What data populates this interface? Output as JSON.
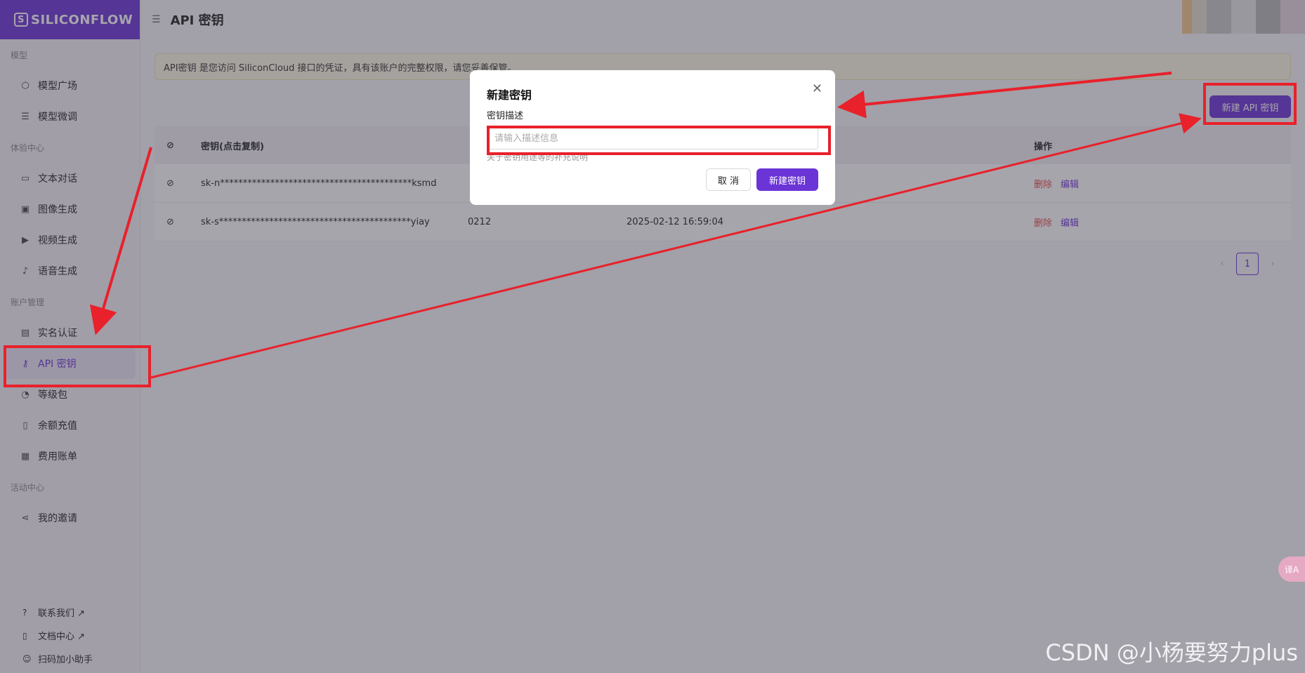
{
  "app": {
    "logo_text": "SILICONFLOW",
    "page_title": "API 密钥"
  },
  "sidebar": {
    "sections": [
      {
        "title": "模型",
        "items": [
          {
            "label": "模型广场",
            "icon": "cube-icon"
          },
          {
            "label": "模型微调",
            "icon": "sliders-icon"
          }
        ]
      },
      {
        "title": "体验中心",
        "items": [
          {
            "label": "文本对话",
            "icon": "chat-icon"
          },
          {
            "label": "图像生成",
            "icon": "image-icon"
          },
          {
            "label": "视频生成",
            "icon": "video-icon"
          },
          {
            "label": "语音生成",
            "icon": "mic-icon"
          }
        ]
      },
      {
        "title": "账户管理",
        "items": [
          {
            "label": "实名认证",
            "icon": "id-card-icon"
          },
          {
            "label": "API 密钥",
            "icon": "key-icon",
            "active": true
          },
          {
            "label": "等级包",
            "icon": "gauge-icon"
          },
          {
            "label": "余额充值",
            "icon": "wallet-icon"
          },
          {
            "label": "费用账单",
            "icon": "bill-icon"
          }
        ]
      },
      {
        "title": "活动中心",
        "items": [
          {
            "label": "我的邀请",
            "icon": "share-icon"
          }
        ]
      }
    ],
    "bottom": [
      {
        "label": "联系我们 ↗"
      },
      {
        "label": "文档中心 ↗"
      },
      {
        "label": "扫码加小助手"
      }
    ]
  },
  "notice": "API密钥 是您访问 SiliconCloud 接口的凭证，具有该账户的完整权限，请您妥善保管。",
  "new_key_button": "新建 API 密钥",
  "table": {
    "headers": [
      "密钥(点击复制)",
      "",
      "",
      "操作"
    ],
    "rows": [
      {
        "key": "sk-n******************************************ksmd",
        "desc": "",
        "created": ""
      },
      {
        "key": "sk-s******************************************yiay",
        "desc": "0212",
        "created": "2025-02-12 16:59:04"
      }
    ],
    "actions": {
      "delete": "删除",
      "edit": "编辑"
    }
  },
  "pagination": {
    "current": "1"
  },
  "modal": {
    "title": "新建密钥",
    "field_label": "密钥描述",
    "placeholder": "请输入描述信息",
    "hint": "关于密钥用途等的补充说明",
    "cancel": "取 消",
    "confirm": "新建密钥"
  },
  "translate_button": "译A",
  "watermark": "CSDN @小杨要努力plus",
  "colors": {
    "accent": "#6b34d6",
    "highlight": "#e8212b",
    "danger": "#e34848"
  }
}
